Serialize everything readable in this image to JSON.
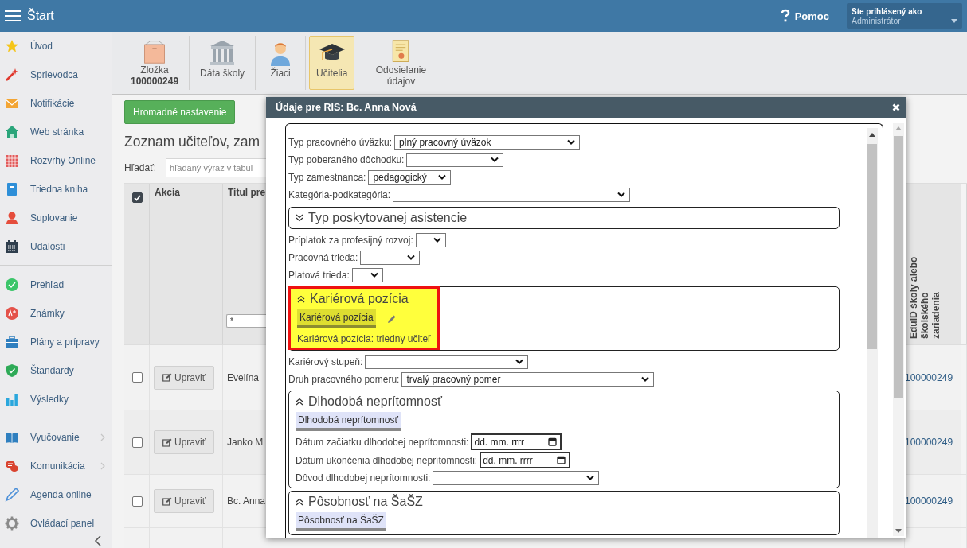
{
  "topbar": {
    "title": "Štart",
    "help": "Pomoc",
    "user_label": "Ste prihlásený ako",
    "user_name": "Administrátor"
  },
  "sidebar": {
    "groups": [
      [
        {
          "label": "Úvod",
          "submenu": false
        },
        {
          "label": "Sprievodca",
          "submenu": false
        },
        {
          "label": "Notifikácie",
          "submenu": false
        },
        {
          "label": "Web stránka",
          "submenu": false
        },
        {
          "label": "Rozvrhy Online",
          "submenu": false
        },
        {
          "label": "Triedna kniha",
          "submenu": false
        },
        {
          "label": "Suplovanie",
          "submenu": false
        },
        {
          "label": "Udalosti",
          "submenu": false
        }
      ],
      [
        {
          "label": "Prehľad",
          "submenu": false
        },
        {
          "label": "Známky",
          "submenu": false
        },
        {
          "label": "Plány a prípravy",
          "submenu": false
        },
        {
          "label": "Štandardy",
          "submenu": false
        },
        {
          "label": "Výsledky",
          "submenu": false
        }
      ],
      [
        {
          "label": "Vyučovanie",
          "submenu": true
        },
        {
          "label": "Komunikácia",
          "submenu": true
        },
        {
          "label": "Agenda online",
          "submenu": false
        },
        {
          "label": "Ovládací panel",
          "submenu": false
        }
      ]
    ]
  },
  "toolbar": [
    {
      "label": "Zložka",
      "sublabel": "100000249",
      "selected": false
    },
    {
      "label": "Dáta školy",
      "selected": false
    },
    {
      "label": "Žiaci",
      "selected": false
    },
    {
      "label": "Učitelia",
      "selected": true
    },
    {
      "label": "Odosielanie údajov",
      "selected": false
    }
  ],
  "main": {
    "bulk_button": "Hromadné nastavenie",
    "heading": "Zoznam učiteľov, zam",
    "search_label": "Hľadať:",
    "search_placeholder": "hľadaný výraz v tabuľ",
    "table": {
      "select_all_checked": true,
      "columns": [
        "Akcia",
        "Titul pre",
        "EduID školy alebo školského zariadenia"
      ],
      "filter_value": "*",
      "rows": [
        {
          "checked": false,
          "action": "Upraviť",
          "name": "Evelína",
          "eduid": "100000249"
        },
        {
          "checked": false,
          "action": "Upraviť",
          "name": "Janko M",
          "eduid": "100000249"
        },
        {
          "checked": false,
          "action": "Upraviť",
          "name": "Bc. Anna",
          "eduid": "100000249"
        }
      ]
    }
  },
  "dialog": {
    "title": "Údaje pre RIS: Bc. Anna Nová",
    "items": [
      {
        "kind": "select",
        "label": "Typ pracovného úväzku:",
        "value": "plný pracovný úväzok"
      },
      {
        "kind": "select",
        "label": "Typ poberaného dôchodku:"
      },
      {
        "kind": "select",
        "label": "Typ zamestnanca:",
        "value": "pedagogický"
      },
      {
        "kind": "select",
        "label": "Kategória-podkategória:"
      },
      {
        "kind": "section",
        "title": "Typ poskytovanej asistencie",
        "expanded": false,
        "highlighted": false
      },
      {
        "kind": "select",
        "label": "Príplatok za profesijný rozvoj:"
      },
      {
        "kind": "select",
        "label": "Pracovná trieda:"
      },
      {
        "kind": "select",
        "label": "Platová trieda:"
      },
      {
        "kind": "section",
        "title": "Kariérová pozícia",
        "expanded": true,
        "highlighted": true,
        "tab": {
          "label": "Kariérová pozícia",
          "editable": true
        },
        "fields": [
          {
            "kind": "text",
            "label": "Kariérová pozícia:",
            "value": "triedny učiteľ"
          }
        ]
      },
      {
        "kind": "select",
        "label": "Kariérový stupeň:"
      },
      {
        "kind": "select",
        "label": "Druh pracovného pomeru:",
        "value": "trvalý pracovný pomer"
      },
      {
        "kind": "section",
        "title": "Dlhodobá neprítomnosť",
        "expanded": true,
        "highlighted": false,
        "tab": {
          "label": "Dlhodobá neprítomnosť",
          "editable": false
        },
        "fields": [
          {
            "kind": "date",
            "label": "Dátum začiatku dlhodobej neprítomnosti:",
            "placeholder": "dd. mm. rrrr"
          },
          {
            "kind": "date",
            "label": "Dátum ukončenia dlhodobej neprítomnosti:",
            "placeholder": "dd. mm. rrrr"
          },
          {
            "kind": "select",
            "label": "Dôvod dlhodobej neprítomnosti:"
          }
        ]
      },
      {
        "kind": "section",
        "title": "Pôsobnosť na ŠaŠZ",
        "expanded": true,
        "highlighted": false,
        "tab": {
          "label": "Pôsobnosť na ŠaŠZ",
          "editable": false
        }
      }
    ]
  }
}
